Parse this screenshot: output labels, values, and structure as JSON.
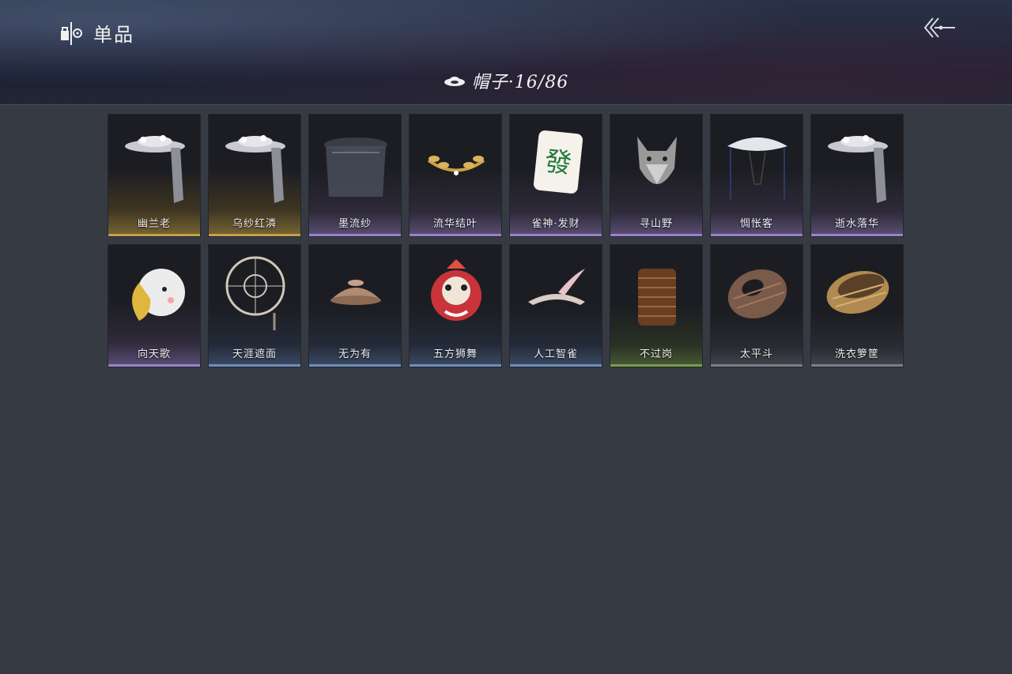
{
  "header": {
    "title": "单品",
    "subtitle": "帽子·16/86",
    "title_icon": "wardrobe-icon",
    "back_icon": "back-arrow-icon",
    "hat_icon": "hat-icon"
  },
  "items": [
    {
      "name": "幽兰老",
      "rarity": "gold",
      "icon": "veil-hat-icon"
    },
    {
      "name": "乌纱红潾",
      "rarity": "gold",
      "icon": "veil-hat-icon"
    },
    {
      "name": "墨流纱",
      "rarity": "purple",
      "icon": "black-veil-hat-icon"
    },
    {
      "name": "流华结叶",
      "rarity": "purple",
      "icon": "laurel-crown-icon"
    },
    {
      "name": "雀神·发财",
      "rarity": "purple",
      "icon": "mahjong-tile-icon"
    },
    {
      "name": "寻山野",
      "rarity": "purple",
      "icon": "wolf-head-icon"
    },
    {
      "name": "惆怅客",
      "rarity": "purple",
      "icon": "white-bamboo-hat-icon"
    },
    {
      "name": "逝水落华",
      "rarity": "purple",
      "icon": "veil-hat-icon"
    },
    {
      "name": "向天歌",
      "rarity": "purple",
      "icon": "goose-hood-icon"
    },
    {
      "name": "天涯遮面",
      "rarity": "blue",
      "icon": "wicker-frame-hat-icon"
    },
    {
      "name": "无为有",
      "rarity": "blue",
      "icon": "clay-bowl-hat-icon"
    },
    {
      "name": "五方狮舞",
      "rarity": "blue",
      "icon": "lion-dance-head-icon"
    },
    {
      "name": "人工智雀",
      "rarity": "blue",
      "icon": "bird-hat-icon"
    },
    {
      "name": "不过岗",
      "rarity": "green",
      "icon": "stacked-bowls-icon"
    },
    {
      "name": "太平斗",
      "rarity": "gray",
      "icon": "woven-basket-hat-icon"
    },
    {
      "name": "洗衣箩筐",
      "rarity": "gray",
      "icon": "laundry-basket-icon"
    }
  ]
}
